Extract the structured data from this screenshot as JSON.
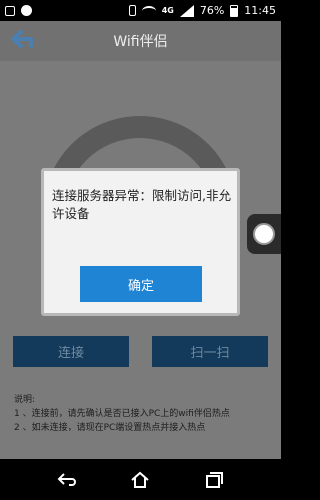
{
  "status_bar": {
    "battery": "76%",
    "time": "11:45",
    "network": "4G"
  },
  "header": {
    "title": "Wifi伴侣"
  },
  "buttons": {
    "connect": "连接",
    "scan": "扫一扫"
  },
  "help": {
    "title": "说明:",
    "lines": [
      "1 、连接前，请先确认是否已接入PC上的wifi伴侣热点",
      "2 、如未连接，请现在PC端设置热点并接入热点"
    ]
  },
  "dialog": {
    "message": "连接服务器异常：限制访问,非允许设备",
    "ok_label": "确定"
  },
  "colors": {
    "accent": "#1f84d4",
    "button_dark": "#133a5a"
  }
}
